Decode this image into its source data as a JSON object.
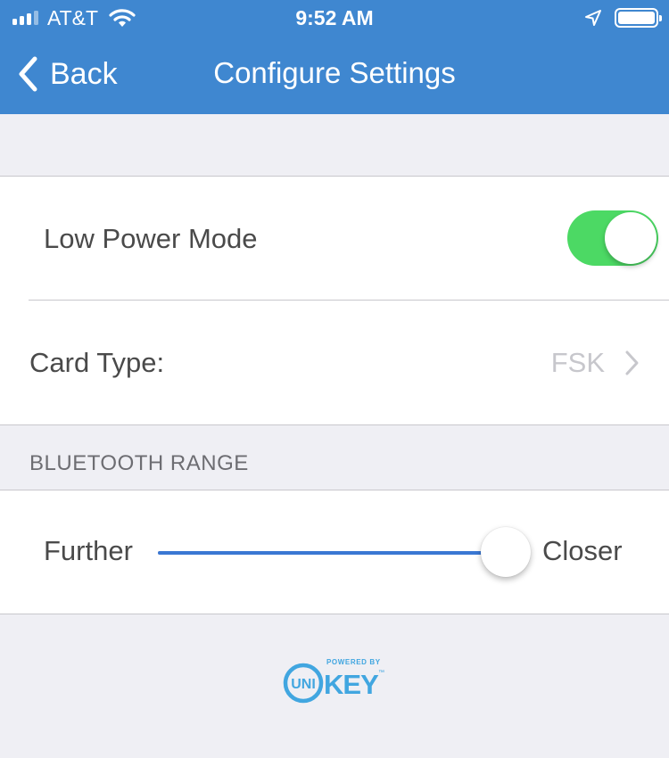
{
  "status_bar": {
    "carrier": "AT&T",
    "time": "9:52 AM",
    "signal_bars": 4,
    "icons": [
      "signal-icon",
      "wifi-icon",
      "location-arrow-icon",
      "battery-icon"
    ]
  },
  "nav": {
    "back_label": "Back",
    "title": "Configure Settings",
    "icons": [
      "chevron-left-icon"
    ]
  },
  "settings": {
    "low_power_mode": {
      "label": "Low Power Mode",
      "enabled": true
    },
    "card_type": {
      "label": "Card Type:",
      "value": "FSK",
      "icon": "chevron-right-icon"
    }
  },
  "bluetooth_range": {
    "header": "BLUETOOTH RANGE",
    "min_label": "Further",
    "max_label": "Closer",
    "value_fraction": 1.0
  },
  "footer": {
    "logo_powered_by": "POWERED BY",
    "logo_uni": "UNI",
    "logo_key": "KEY",
    "logo_tm": "™"
  },
  "colors": {
    "nav_background": "#3f87d0",
    "toggle_on": "#4cd964",
    "slider_fill": "#3a77d3",
    "logo_blue": "#41a6e0",
    "page_background": "#efeff4"
  }
}
